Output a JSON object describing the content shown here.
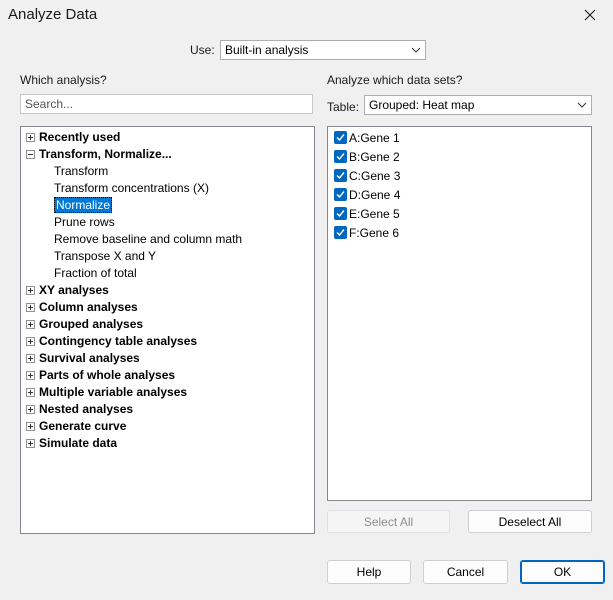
{
  "window": {
    "title": "Analyze Data"
  },
  "use": {
    "label": "Use:",
    "value": "Built-in analysis"
  },
  "left": {
    "heading": "Which analysis?",
    "search_placeholder": "Search...",
    "tree": [
      {
        "label": "Recently used",
        "expanded": false
      },
      {
        "label": "Transform, Normalize...",
        "expanded": true,
        "children": [
          "Transform",
          "Transform concentrations (X)",
          "Normalize",
          "Prune rows",
          "Remove baseline and column math",
          "Transpose X and Y",
          "Fraction of total"
        ],
        "selected_child": "Normalize"
      },
      {
        "label": "XY analyses",
        "expanded": false
      },
      {
        "label": "Column analyses",
        "expanded": false
      },
      {
        "label": "Grouped analyses",
        "expanded": false
      },
      {
        "label": "Contingency table analyses",
        "expanded": false
      },
      {
        "label": "Survival analyses",
        "expanded": false
      },
      {
        "label": "Parts of whole analyses",
        "expanded": false
      },
      {
        "label": "Multiple variable analyses",
        "expanded": false
      },
      {
        "label": "Nested analyses",
        "expanded": false
      },
      {
        "label": "Generate curve",
        "expanded": false
      },
      {
        "label": "Simulate data",
        "expanded": false
      }
    ]
  },
  "right": {
    "heading": "Analyze which data sets?",
    "table_label": "Table:",
    "table_value": "Grouped: Heat map",
    "datasets": [
      {
        "label": "A:Gene 1",
        "checked": true
      },
      {
        "label": "B:Gene 2",
        "checked": true
      },
      {
        "label": "C:Gene 3",
        "checked": true
      },
      {
        "label": "D:Gene 4",
        "checked": true
      },
      {
        "label": "E:Gene 5",
        "checked": true
      },
      {
        "label": "F:Gene 6",
        "checked": true
      }
    ],
    "select_all": "Select All",
    "deselect_all": "Deselect All"
  },
  "footer": {
    "help": "Help",
    "cancel": "Cancel",
    "ok": "OK"
  },
  "colors": {
    "accent": "#0067c0",
    "selection": "#0078d7"
  },
  "icons": {
    "close": "close-icon",
    "dropdown": "chevron-down-icon",
    "expand": "plus-box-icon",
    "collapse": "minus-box-icon",
    "check": "checkmark-icon"
  }
}
